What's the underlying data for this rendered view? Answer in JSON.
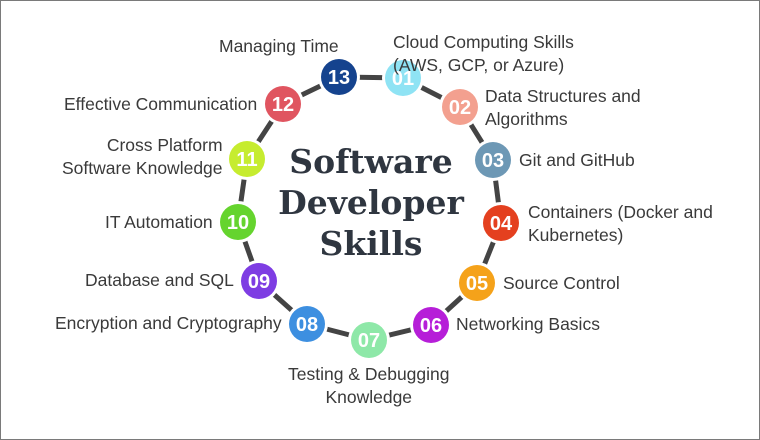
{
  "title_lines": [
    "Software",
    "Developer",
    "Skills"
  ],
  "skills": [
    {
      "number": "01",
      "lines": [
        "Cloud Computing Skills",
        "(AWS, GCP, or Azure)"
      ],
      "color": "#8fe3f4"
    },
    {
      "number": "02",
      "lines": [
        "Data Structures and",
        "Algorithms"
      ],
      "color": "#f3a08f"
    },
    {
      "number": "03",
      "lines": [
        "Git and GitHub"
      ],
      "color": "#6d98b5"
    },
    {
      "number": "04",
      "lines": [
        "Containers (Docker and",
        "Kubernetes)"
      ],
      "color": "#e4401f"
    },
    {
      "number": "05",
      "lines": [
        "Source Control"
      ],
      "color": "#f5a21a"
    },
    {
      "number": "06",
      "lines": [
        "Networking Basics"
      ],
      "color": "#b61ed8"
    },
    {
      "number": "07",
      "lines": [
        "Testing & Debugging",
        "Knowledge"
      ],
      "color": "#8ee8a8"
    },
    {
      "number": "08",
      "lines": [
        "Encryption and Cryptography"
      ],
      "color": "#3d8fe0"
    },
    {
      "number": "09",
      "lines": [
        "Database and SQL"
      ],
      "color": "#7e3de3"
    },
    {
      "number": "10",
      "lines": [
        "IT Automation"
      ],
      "color": "#65d42e"
    },
    {
      "number": "11",
      "lines": [
        "Cross Platform",
        "Software Knowledge"
      ],
      "color": "#c6ec2f"
    },
    {
      "number": "12",
      "lines": [
        "Effective Communication"
      ],
      "color": "#e05560"
    },
    {
      "number": "13",
      "lines": [
        "Managing Time"
      ],
      "color": "#15438e"
    }
  ],
  "ring_color": "#444444"
}
